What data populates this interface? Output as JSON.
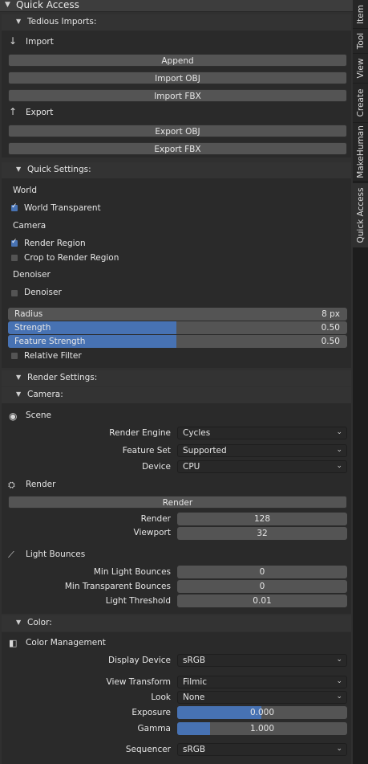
{
  "panel": {
    "title": "Quick Access"
  },
  "tedious_imports": {
    "title": "Tedious Imports:",
    "import_label": "Import",
    "buttons": [
      "Append",
      "Import OBJ",
      "Import FBX"
    ],
    "export_label": "Export",
    "export_buttons": [
      "Export OBJ",
      "Export FBX"
    ]
  },
  "quick_settings": {
    "title": "Quick Settings:",
    "world_label": "World",
    "world_transparent": {
      "label": "World Transparent",
      "checked": true
    },
    "camera_label": "Camera",
    "render_region": {
      "label": "Render Region",
      "checked": true
    },
    "crop_region": {
      "label": "Crop to Render Region",
      "checked": false
    },
    "denoiser_label": "Denoiser",
    "denoiser": {
      "label": "Denoiser",
      "checked": false
    },
    "radius": {
      "label": "Radius",
      "value": "8 px"
    },
    "strength": {
      "label": "Strength",
      "value": "0.50",
      "fraction": 0.5
    },
    "feature_strength": {
      "label": "Feature Strength",
      "value": "0.50",
      "fraction": 0.5
    },
    "relative_filter": {
      "label": "Relative Filter",
      "checked": false
    }
  },
  "render_settings": {
    "title": "Render Settings:",
    "camera_title": "Camera:",
    "scene_label": "Scene",
    "render_engine": {
      "label": "Render Engine",
      "value": "Cycles"
    },
    "feature_set": {
      "label": "Feature Set",
      "value": "Supported"
    },
    "device": {
      "label": "Device",
      "value": "CPU"
    },
    "render_label": "Render",
    "render_button": "Render",
    "render_samples": {
      "label": "Render",
      "value": "128"
    },
    "viewport_samples": {
      "label": "Viewport",
      "value": "32"
    },
    "light_bounces_label": "Light Bounces",
    "min_light_bounces": {
      "label": "Min Light Bounces",
      "value": "0"
    },
    "min_transparent_bounces": {
      "label": "Min Transparent Bounces",
      "value": "0"
    },
    "light_threshold": {
      "label": "Light Threshold",
      "value": "0.01"
    }
  },
  "color": {
    "title": "Color:",
    "management_label": "Color Management",
    "display_device": {
      "label": "Display Device",
      "value": "sRGB"
    },
    "view_transform": {
      "label": "View Transform",
      "value": "Filmic"
    },
    "look": {
      "label": "Look",
      "value": "None"
    },
    "exposure": {
      "label": "Exposure",
      "value": "0.000",
      "fraction": 0.5
    },
    "gamma": {
      "label": "Gamma",
      "value": "1.000",
      "fraction": 0.19
    },
    "sequencer": {
      "label": "Sequencer",
      "value": "sRGB"
    }
  },
  "tabs": [
    "Item",
    "Tool",
    "View",
    "Create",
    "MakeHuman",
    "Quick Access"
  ],
  "active_tab": "Quick Access",
  "colors": {
    "accent": "#4772b3",
    "panel": "#303030",
    "button": "#545454"
  }
}
